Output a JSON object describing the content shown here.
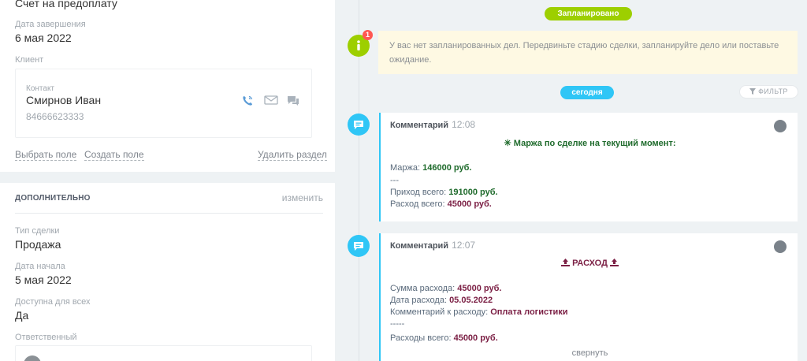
{
  "left": {
    "top_value": "Счет на предоплату",
    "end_date_label": "Дата завершения",
    "end_date_value": "6 мая 2022",
    "client_label": "Клиент",
    "contact": {
      "label": "Контакт",
      "name": "Смирнов Иван",
      "phone": "84666623333"
    },
    "links": {
      "select_field": "Выбрать поле",
      "create_field": "Создать поле",
      "delete_section": "Удалить раздел"
    },
    "additional": {
      "title": "ДОПОЛНИТЕЛЬНО",
      "edit": "изменить",
      "deal_type_label": "Тип сделки",
      "deal_type_value": "Продажа",
      "start_date_label": "Дата начала",
      "start_date_value": "5 мая 2022",
      "available_label": "Доступна для всех",
      "available_value": "Да",
      "responsible_label": "Ответственный"
    }
  },
  "timeline": {
    "planned_pill": "Запланировано",
    "notice_badge": "1",
    "notice_text": "У вас нет запланированных дел. Передвиньте стадию сделки, запланируйте дело или поставьте ожидание.",
    "today_pill": "сегодня",
    "filter_label": "ФИЛЬТР",
    "comment1": {
      "title": "Комментарий",
      "time": "12:08",
      "heading": "✳ Маржа по сделке на текущий момент:",
      "margin_label": "Маржа:",
      "margin_value": "146000 руб.",
      "separator": "---",
      "income_label": "Приход всего:",
      "income_value": "191000 руб.",
      "expense_label": "Расход всего:",
      "expense_value": "45000 руб."
    },
    "comment2": {
      "title": "Комментарий",
      "time": "12:07",
      "heading": "РАСХОД",
      "sum_label": "Сумма расхода:",
      "sum_value": "45000 руб.",
      "date_label": "Дата расхода:",
      "date_value": "05.05.2022",
      "comment_label": "Комментарий к расходу:",
      "comment_value": "Оплата логистики",
      "separator": "-----",
      "total_label": "Расходы всего:",
      "total_value": "45000 руб.",
      "collapse": "свернуть"
    }
  },
  "colors": {
    "green": "#9dcf00",
    "blue": "#2fc6f6",
    "badge": "#ff5752",
    "dark_green": "#1f6b2c",
    "maroon": "#7b1f44"
  }
}
